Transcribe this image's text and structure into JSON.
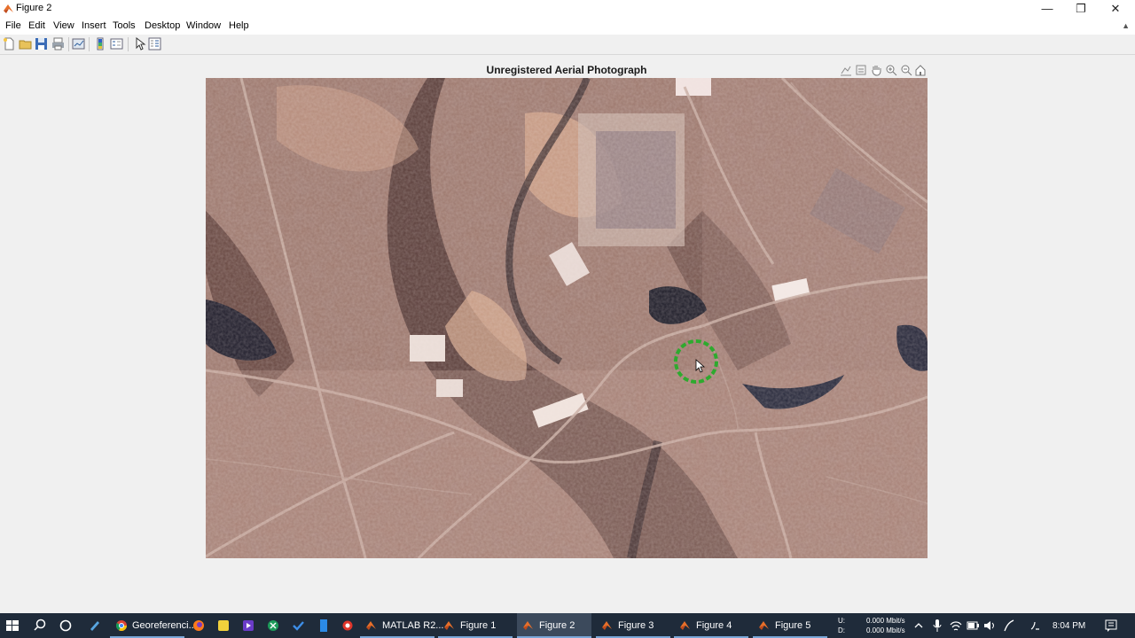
{
  "window": {
    "title": "Figure 2"
  },
  "menu": {
    "items": [
      "File",
      "Edit",
      "View",
      "Insert",
      "Tools",
      "Desktop",
      "Window",
      "Help"
    ]
  },
  "toolbar": {
    "icons": [
      "new-figure-icon",
      "open-file-icon",
      "save-icon",
      "print-icon",
      "link-plot-icon",
      "colorbar-icon",
      "legend-icon",
      "edit-plot-icon",
      "property-inspector-icon"
    ]
  },
  "axes": {
    "title": "Unregistered Aerial Photograph",
    "toolbar_icons": [
      "data-tips-icon",
      "brush-icon",
      "pan-icon",
      "zoom-in-icon",
      "zoom-out-icon",
      "home-icon"
    ]
  },
  "taskbar": {
    "apps": [
      {
        "label": "Georeferenci...",
        "icon": "chrome-icon"
      },
      {
        "label": "MATLAB R2...",
        "icon": "matlab-icon"
      },
      {
        "label": "Figure 1",
        "icon": "matlab-figure-icon"
      },
      {
        "label": "Figure 2",
        "icon": "matlab-figure-icon",
        "active": true
      },
      {
        "label": "Figure 3",
        "icon": "matlab-figure-icon"
      },
      {
        "label": "Figure 4",
        "icon": "matlab-figure-icon"
      },
      {
        "label": "Figure 5",
        "icon": "matlab-figure-icon"
      }
    ],
    "net": {
      "up_label": "U:",
      "up_value": "0.000 Mbit/s",
      "down_label": "D:",
      "down_value": "0.000 Mbit/s"
    },
    "clock": "8:04 PM"
  },
  "colors": {
    "taskbar": "#1f2b3a",
    "figure_bg": "#f0f0f0",
    "highlight_ring": "#2eaa2e"
  }
}
